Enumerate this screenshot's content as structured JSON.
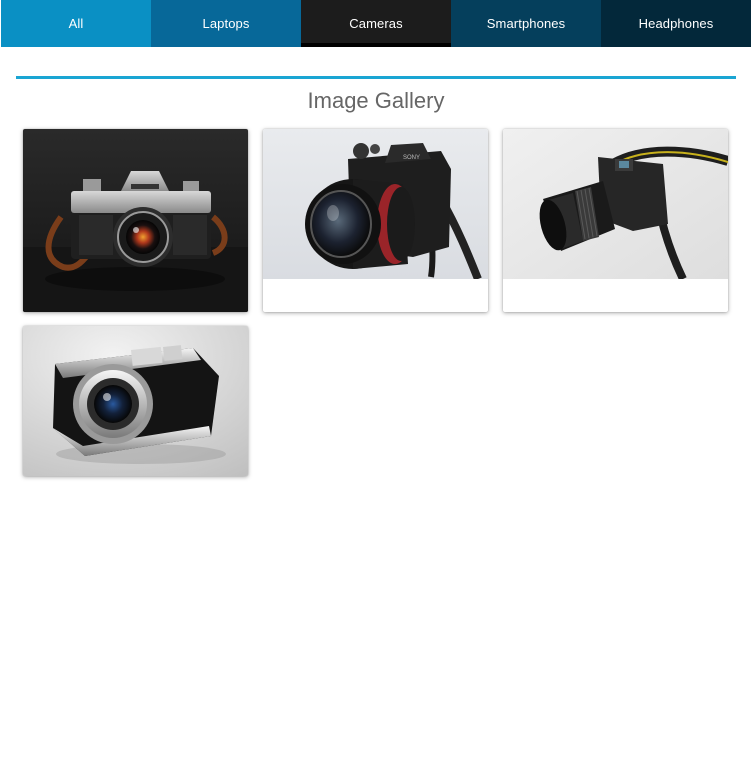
{
  "tabs": [
    {
      "label": "All"
    },
    {
      "label": "Laptops"
    },
    {
      "label": "Cameras"
    },
    {
      "label": "Smartphones"
    },
    {
      "label": "Headphones"
    }
  ],
  "active_tab": "Cameras",
  "colors": {
    "tab_all": "#0a90c4",
    "tab_laptops": "#076899",
    "tab_cameras": "#1c1c1c",
    "tab_smartphones": "#053f5c",
    "tab_headphones": "#03283a",
    "accent_rule": "#1aa5d3",
    "heading_text": "#666666"
  },
  "gallery": {
    "title": "Image Gallery",
    "items": [
      {
        "subject": "vintage-film-camera",
        "icon": "camera-photo"
      },
      {
        "subject": "mirrorless-camera",
        "icon": "camera-photo"
      },
      {
        "subject": "dslr-camera-with-strap",
        "icon": "camera-photo"
      },
      {
        "subject": "rangefinder-camera",
        "icon": "camera-photo"
      }
    ]
  }
}
